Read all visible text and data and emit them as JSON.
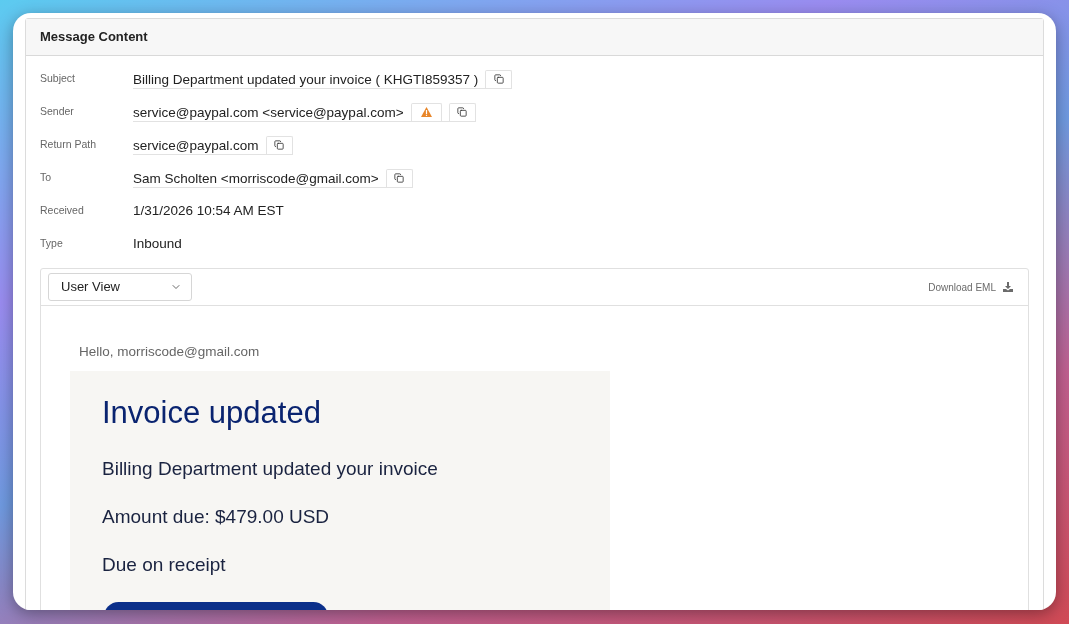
{
  "panel": {
    "title": "Message Content"
  },
  "fields": [
    {
      "label": "Subject",
      "value": "Billing Department updated your invoice ( KHGTI859357 )",
      "copyable": true,
      "warning": false
    },
    {
      "label": "Sender",
      "value": "service@paypal.com <service@paypal.com>",
      "copyable": true,
      "warning": true
    },
    {
      "label": "Return Path",
      "value": "service@paypal.com",
      "copyable": true,
      "warning": false
    },
    {
      "label": "To",
      "value": "Sam Scholten <morriscode@gmail.com>",
      "copyable": true,
      "warning": false
    },
    {
      "label": "Received",
      "value": "1/31/2026 10:54 AM EST",
      "copyable": false,
      "warning": false
    },
    {
      "label": "Type",
      "value": "Inbound",
      "copyable": false,
      "warning": false
    }
  ],
  "viewer": {
    "view_select": {
      "value": "User View"
    },
    "download": {
      "label": "Download EML"
    }
  },
  "email": {
    "greeting": "Hello, morriscode@gmail.com",
    "title": "Invoice updated",
    "lines": [
      "Billing Department updated your invoice",
      "Amount due: $479.00 USD",
      "Due on receipt"
    ]
  }
}
